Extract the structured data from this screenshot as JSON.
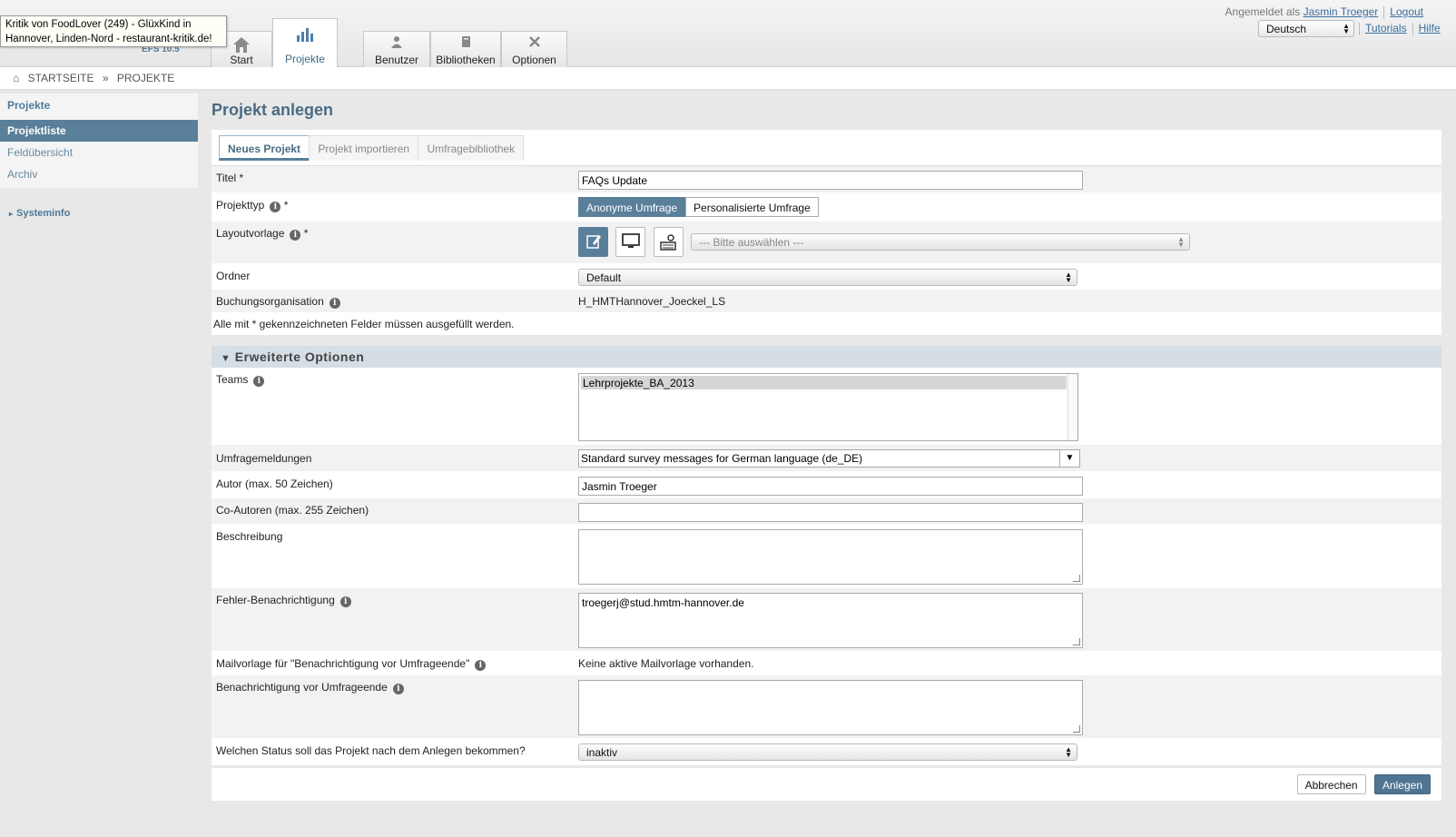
{
  "tooltip": "Kritik von FoodLover (249) - GlüxKind in Hannover, Linden-Nord - restaurant-kritik.de!",
  "version": "EFS 10.5",
  "nav": {
    "start": "Start",
    "projekte": "Projekte",
    "benutzer": "Benutzer",
    "bibliotheken": "Bibliotheken",
    "optionen": "Optionen"
  },
  "user": {
    "logged_in_as": "Angemeldet als",
    "name": "Jasmin Troeger",
    "logout": "Logout",
    "language": "Deutsch",
    "tutorials": "Tutorials",
    "help": "Hilfe"
  },
  "breadcrumb": {
    "home": "STARTSEITE",
    "separator": "»",
    "current": "PROJEKTE"
  },
  "sidebar": {
    "heading": "Projekte",
    "items": [
      "Projektliste",
      "Feldübersicht",
      "Archiv"
    ],
    "systeminfo": "Systeminfo"
  },
  "page": {
    "title": "Projekt anlegen",
    "tabs": [
      "Neues Projekt",
      "Projekt importieren",
      "Umfragebibliothek"
    ]
  },
  "form": {
    "titel_label": "Titel *",
    "titel_value": "FAQs Update",
    "projekttyp_label": "Projekttyp",
    "required": "*",
    "projekttyp_options": [
      "Anonyme Umfrage",
      "Personalisierte Umfrage"
    ],
    "layout_label": "Layoutvorlage",
    "layout_select": "--- Bitte auswählen ---",
    "ordner_label": "Ordner",
    "ordner_value": "Default",
    "buchung_label": "Buchungsorganisation",
    "buchung_value": "H_HMTHannover_Joeckel_LS",
    "required_note": "Alle mit * gekennzeichneten Felder müssen ausgefüllt werden."
  },
  "advanced": {
    "heading": "Erweiterte Optionen",
    "teams_label": "Teams",
    "teams_selected": "Lehrprojekte_BA_2013",
    "umfrage_label": "Umfragemeldungen",
    "umfrage_value": "Standard survey messages for German language (de_DE)",
    "autor_label": "Autor (max. 50 Zeichen)",
    "autor_value": "Jasmin Troeger",
    "coautoren_label": "Co-Autoren (max. 255 Zeichen)",
    "coautoren_value": "",
    "beschreibung_label": "Beschreibung",
    "beschreibung_value": "",
    "fehler_label": "Fehler-Benachrichtigung",
    "fehler_value": "troegerj@stud.hmtm-hannover.de",
    "mailvorlage_label": "Mailvorlage für \"Benachrichtigung vor Umfrageende\"",
    "mailvorlage_value": "Keine aktive Mailvorlage vorhanden.",
    "benachr_label": "Benachrichtigung vor Umfrageende",
    "benachr_value": "",
    "status_label": "Welchen Status soll das Projekt nach dem Anlegen bekommen?",
    "status_value": "inaktiv"
  },
  "buttons": {
    "cancel": "Abbrechen",
    "create": "Anlegen"
  },
  "icons": {
    "info": "i",
    "home": "⌂",
    "chevron": "▾"
  },
  "colors": {
    "accent": "#5a7f9a",
    "title": "#4a6b82",
    "link": "#3a6fa0"
  }
}
